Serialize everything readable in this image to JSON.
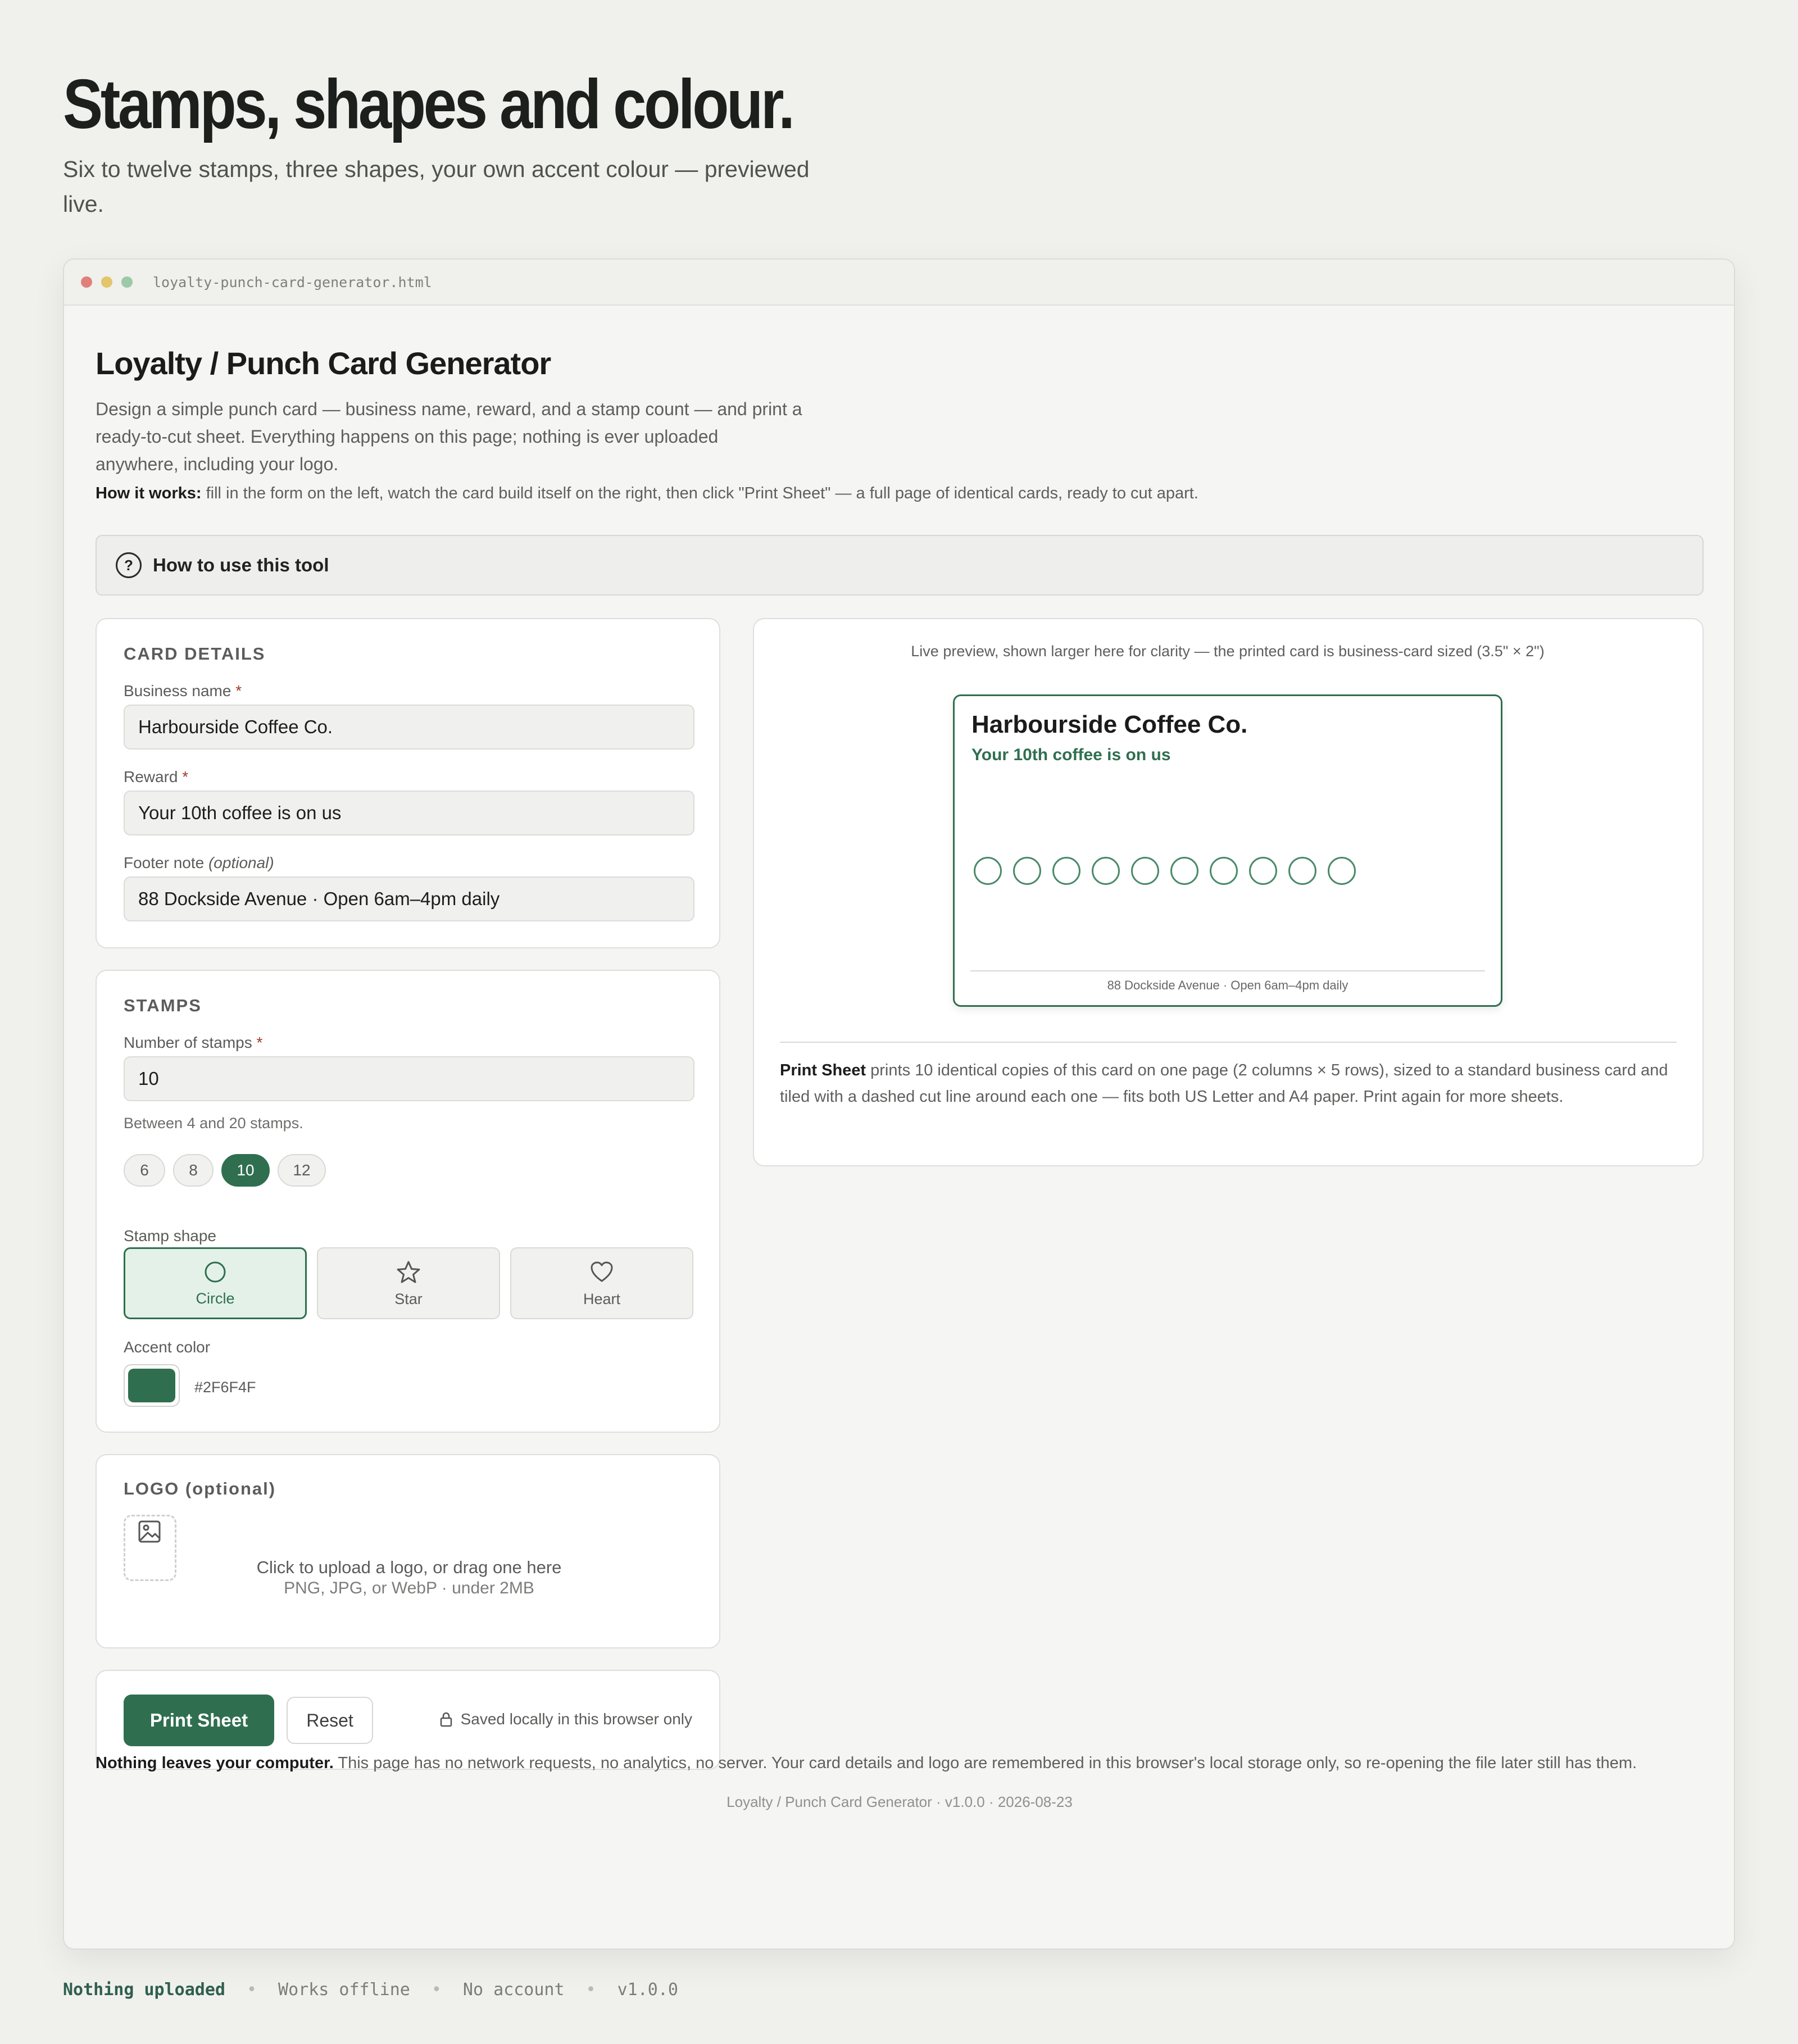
{
  "hero": {
    "title": "Stamps, shapes and colour.",
    "subtitle": "Six to twelve stamps, three shapes, your own accent colour — previewed live."
  },
  "window": {
    "filename": "loyalty-punch-card-generator.html",
    "dots": [
      "#e0807a",
      "#e3c56a",
      "#9cc9a8"
    ]
  },
  "app": {
    "title": "Loyalty / Punch Card Generator",
    "description": "Design a simple punch card — business name, reward, and a stamp count — and print a ready-to-cut sheet. Everything happens on this page; nothing is ever uploaded anywhere, including your logo.",
    "how_label": "How it works:",
    "how_text": " fill in the form on the left, watch the card build itself on the right, then click \"Print Sheet\" — a full page of identical cards, ready to cut apart.",
    "help_label": "How to use this tool",
    "help_icon": "?"
  },
  "card_details": {
    "heading": "CARD DETAILS",
    "business_label": "Business name",
    "business_value": "Harbourside Coffee Co.",
    "reward_label": "Reward",
    "reward_value": "Your 10th coffee is on us",
    "footer_label": "Footer note",
    "footer_optional": "(optional)",
    "footer_value": "88 Dockside Avenue · Open 6am–4pm daily",
    "required_mark": "*"
  },
  "stamps": {
    "heading": "STAMPS",
    "count_label": "Number of stamps",
    "count_value": "10",
    "count_hint": "Between 4 and 20 stamps.",
    "presets": [
      "6",
      "8",
      "10",
      "12"
    ],
    "selected_preset": "10",
    "shape_label": "Stamp shape",
    "shapes": [
      "Circle",
      "Star",
      "Heart"
    ],
    "selected_shape": "Circle",
    "accent_label": "Accent color",
    "accent_hex": "#2F6F4F",
    "accent_color": "#2f6f4f"
  },
  "logo": {
    "heading": "LOGO (optional)",
    "upload_text": "Click to upload a logo, or drag one here",
    "upload_hint": "PNG, JPG, or WebP · under 2MB"
  },
  "actions": {
    "print_label": "Print Sheet",
    "reset_label": "Reset",
    "saved_text": "Saved locally in this browser only"
  },
  "preview": {
    "caption": "Live preview, shown larger here for clarity — the printed card is business-card sized (3.5\" × 2\")",
    "card_name": "Harbourside Coffee Co.",
    "card_reward": "Your 10th coffee is on us",
    "card_footer": "88 Dockside Avenue · Open 6am–4pm daily",
    "stamp_count": 10,
    "print_label": "Print Sheet",
    "print_text": " prints 10 identical copies of this card on one page (2 columns × 5 rows), sized to a standard business card and tiled with a dashed cut line around each one — fits both US Letter and A4 paper. Print again for more sheets."
  },
  "footer": {
    "privacy_label": "Nothing leaves your computer.",
    "privacy_text": " This page has no network requests, no analytics, no server. Your card details and logo are remembered in this browser's local storage only, so re-opening the file later still has them.",
    "version": "Loyalty / Punch Card Generator · v1.0.0 · 2026-08-23"
  },
  "bottom_strip": [
    "Nothing uploaded",
    "Works offline",
    "No account",
    "v1.0.0"
  ],
  "bottom_separator": "•"
}
